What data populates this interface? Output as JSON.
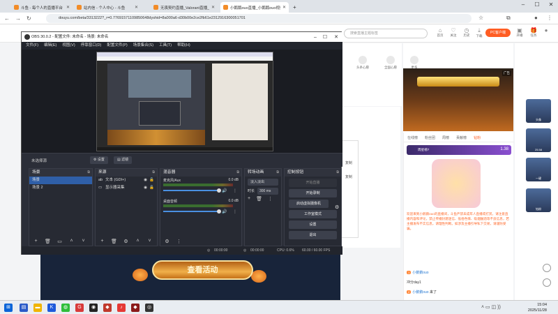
{
  "browser": {
    "tabs": [
      {
        "label": "斗鱼 - 每个人的直播平台",
        "active": false
      },
      {
        "label": "站内信 - 个人中心 - 斗鱼",
        "active": false
      },
      {
        "label": "无畏契约直播_Valorant直播_",
        "active": false
      },
      {
        "label": "小鹅鹅ouo直播_小鹅鹅ouo视频",
        "active": true
      }
    ],
    "url": "douyu.com/beta/3313222?_r=0.77691571109850648dyshid=8a000a6-d30b00e2ce2fb61e2312916300051701",
    "new_tab": "+"
  },
  "douyu": {
    "search_placeholder": "搜索直播主题标签",
    "header_icons": [
      "首页",
      "关注",
      "历史",
      "下载",
      "开播",
      "任务"
    ],
    "pc_button": "PC客户端",
    "room_icons": [
      "头条心愿",
      "全国心愿"
    ],
    "more": "更多",
    "watch_button": "查看活动",
    "chat_tabs": [
      "在线榜",
      "粉丝团",
      "周榜",
      "贡献榜",
      "钻粉"
    ],
    "fan_badge": "周星榜7",
    "rank_num": "1.38",
    "notice_text": "欢迎来到小鹅鹅ouo的直播间，斗鱼严禁未成年人直播或打赏。请注意直播内容和评论，禁止传播封建迷信、低俗色情、吸烟酗酒等不良信息，若主播发布不实信息，请理性判断。如涉及主播引导私下交易，请谨防受骗。",
    "chat": [
      {
        "badge": "1",
        "name": "小鹅鹅ouo",
        "text": ""
      },
      {
        "badge": "",
        "name": "",
        "text": "冲分day1"
      },
      {
        "badge": "2",
        "name": "小鹅鹅ouo",
        "text": "来了"
      }
    ],
    "gift_cards": [
      "头像",
      "25.58",
      "一键",
      "钻粉"
    ],
    "side_checks": [
      "复制",
      "复制"
    ]
  },
  "obs": {
    "title": "OBS 30.0.2 - 配置文件: 未命名 - 场景: 未命名",
    "menu": [
      "文件(F)",
      "编辑(E)",
      "视图(V)",
      "停靠窗口(D)",
      "配置文件(P)",
      "场景集合(S)",
      "工具(T)",
      "帮助(H)"
    ],
    "no_source": "未选择源",
    "props_btn": "设置",
    "filters_btn": "滤镜",
    "docks": {
      "scenes": {
        "title": "场景",
        "items": [
          "场景",
          "场景 2"
        ]
      },
      "sources": {
        "title": "来源",
        "items": [
          "文本 (GDI+)",
          "显示器采集"
        ]
      },
      "mixer": {
        "title": "混音器",
        "channels": [
          {
            "name": "麦克风/Aux",
            "db": "0.0 dB"
          },
          {
            "name": "桌面音频",
            "db": "0.0 dB"
          }
        ]
      },
      "transitions": {
        "title": "转场动画",
        "type": "淡入淡出",
        "duration_label": "时长",
        "duration": "300 ms"
      },
      "controls": {
        "title": "控制按钮",
        "buttons": [
          "开始直播",
          "开始录制",
          "启动虚拟摄像机",
          "工作室模式",
          "设置",
          "退出"
        ]
      }
    },
    "status": {
      "rec1": "00:00:00",
      "rec2": "00:00:00",
      "cpu": "CPU: 0.6%",
      "fps": "60.00 / 60.00 FPS"
    }
  },
  "taskbar": {
    "time": "15:04",
    "date": "2025/11/28"
  }
}
